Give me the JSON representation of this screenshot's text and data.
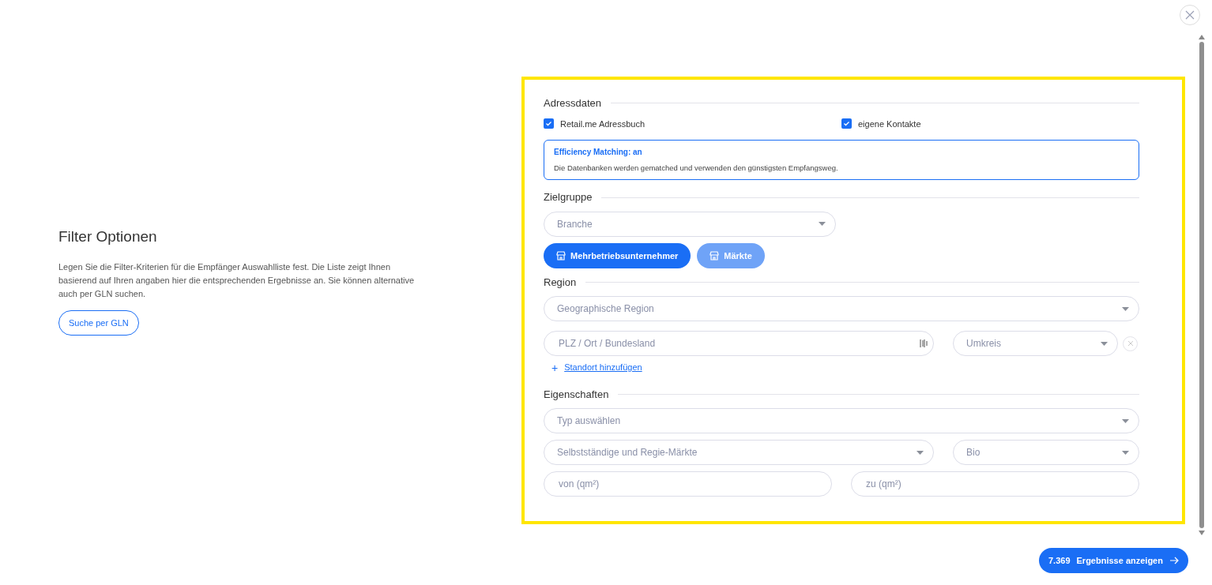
{
  "intro": {
    "title": "Filter Optionen",
    "text": "Legen Sie die Filter-Kriterien für die Empfänger Auswahlliste fest. Die Liste zeigt Ihnen basierend auf Ihren angaben hier die entsprechenden Ergebnisse an. Sie können alternative auch per GLN suchen.",
    "button": "Suche per GLN"
  },
  "adressdaten": {
    "heading": "Adressdaten",
    "checkboxes": [
      {
        "label": "Retail.me Adressbuch",
        "checked": true
      },
      {
        "label": "eigene Kontakte",
        "checked": true
      }
    ],
    "notice": {
      "title": "Efficiency Matching: an",
      "text": "Die Datenbanken werden gematched und verwenden den günstigsten Empfangsweg."
    }
  },
  "zielgruppe": {
    "heading": "Zielgruppe",
    "select": {
      "placeholder": "Branche"
    },
    "toggles": [
      {
        "label": "Mehrbetriebsunternehmer",
        "selected": true
      },
      {
        "label": "Märkte",
        "selected": false
      }
    ]
  },
  "region": {
    "heading": "Region",
    "select": {
      "placeholder": "Geographische Region"
    },
    "location": {
      "placeholder": "PLZ / Ort / Bundesland"
    },
    "radius": {
      "placeholder": "Umkreis"
    },
    "add_link": {
      "icon": "+",
      "label": "Standort hinzufügen"
    }
  },
  "eigenschaften": {
    "heading": "Eigenschaften",
    "type": {
      "placeholder": "Typ auswählen"
    },
    "market_type": {
      "placeholder": "Selbstständige und Regie-Märkte"
    },
    "label": {
      "placeholder": "Bio"
    },
    "area_from": {
      "placeholder": "von (qm²)"
    },
    "area_to": {
      "placeholder": "zu (qm²)"
    }
  },
  "result_button": {
    "count": "7.369",
    "label": "Ergebnisse anzeigen"
  }
}
